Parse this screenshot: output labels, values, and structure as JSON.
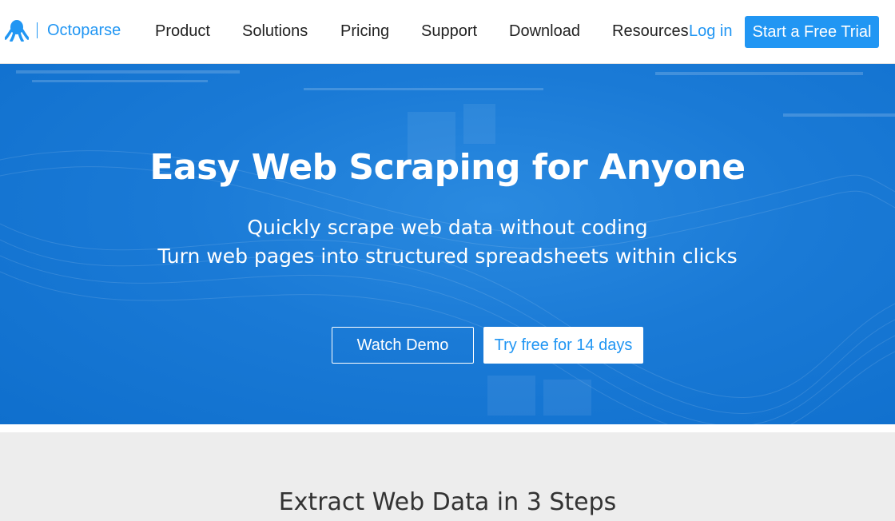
{
  "nav": {
    "brand": "Octoparse",
    "items": [
      "Product",
      "Solutions",
      "Pricing",
      "Support",
      "Download",
      "Resources"
    ],
    "login": "Log in",
    "trial": "Start a Free Trial"
  },
  "hero": {
    "title": "Easy Web Scraping for Anyone",
    "subtitle1": "Quickly scrape web data without coding",
    "subtitle2": "Turn web pages into structured spreadsheets within clicks",
    "watch_demo": "Watch Demo",
    "try_free": "Try free for 14 days"
  },
  "section": {
    "title": "Extract Web Data in 3 Steps"
  },
  "colors": {
    "accent": "#2196f3",
    "hero_bg": "#1a7ad6",
    "section_bg": "#ededed"
  }
}
